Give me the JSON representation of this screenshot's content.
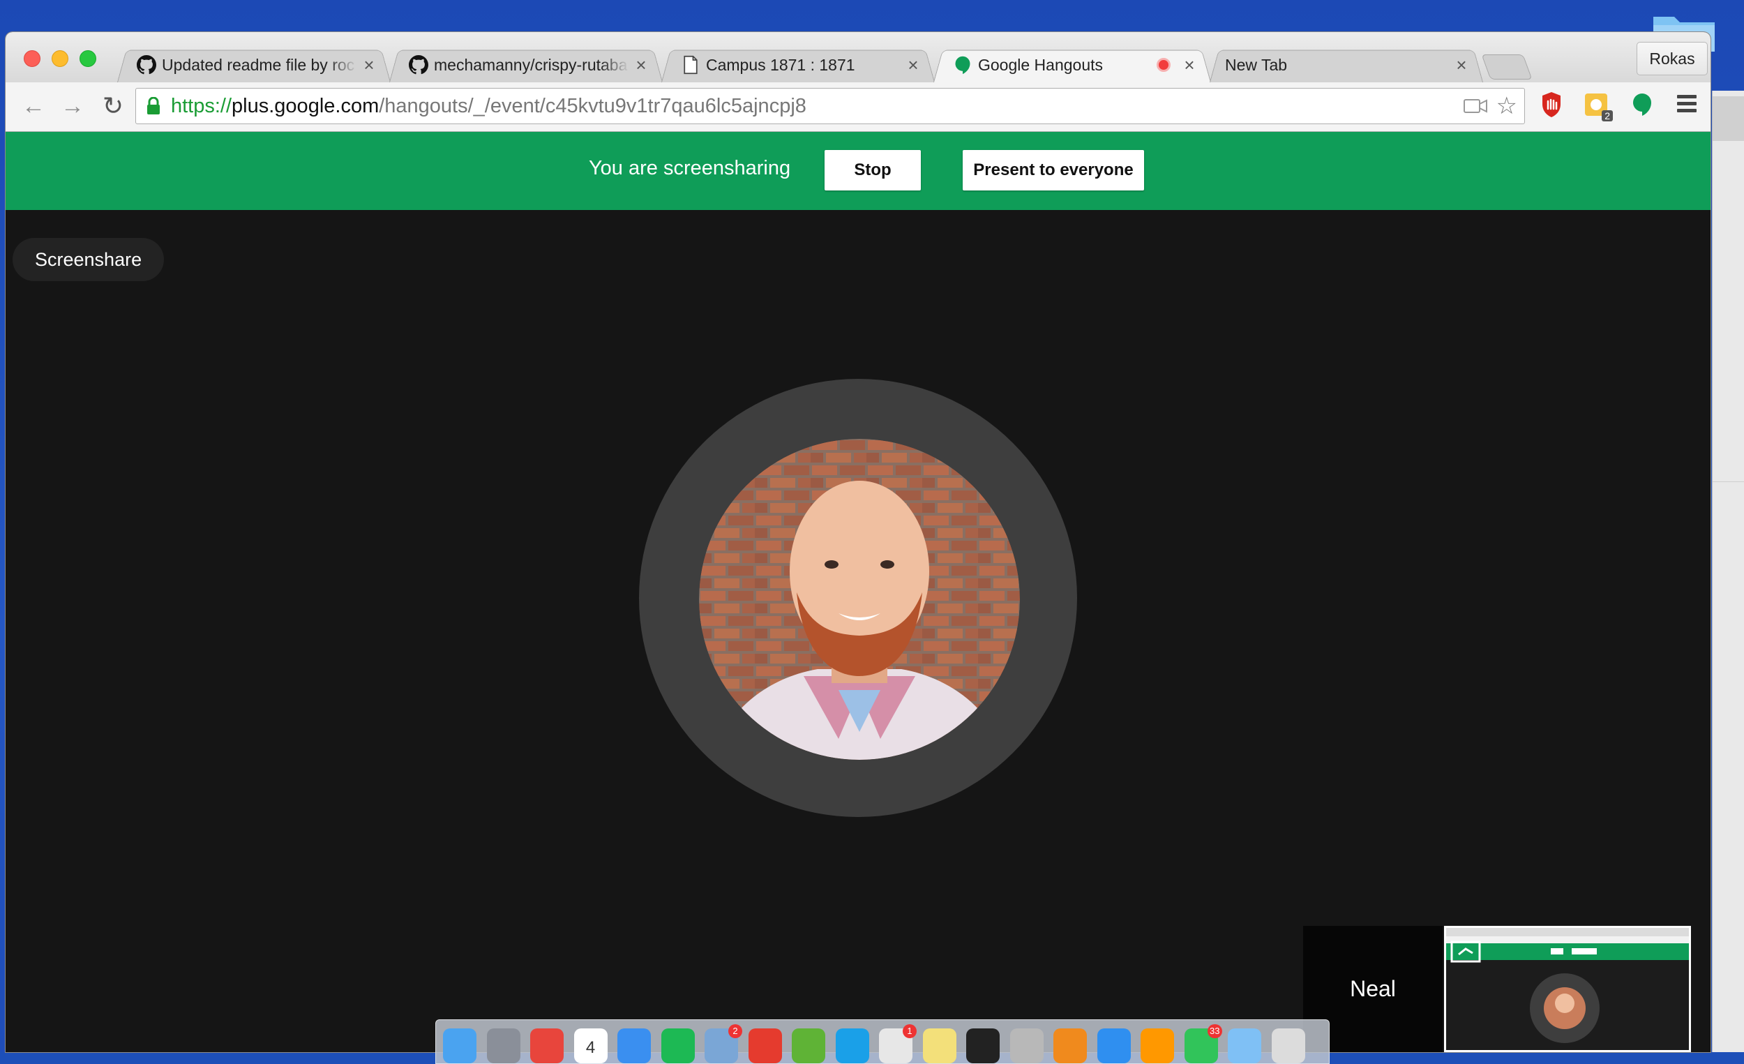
{
  "browser": {
    "tabs": [
      {
        "title": "Updated readme file by roc",
        "favicon": "github-icon",
        "active": false
      },
      {
        "title": "mechamanny/crispy-rutaba",
        "favicon": "github-icon",
        "active": false
      },
      {
        "title": "Campus 1871 : 1871",
        "favicon": "document-icon",
        "active": false
      },
      {
        "title": "Google Hangouts",
        "favicon": "hangouts-icon",
        "active": true,
        "recording": true
      },
      {
        "title": "New Tab",
        "favicon": null,
        "active": false
      }
    ],
    "close_glyph": "×",
    "profile_name": "Rokas",
    "url": {
      "scheme": "https://",
      "host": "plus.google.com",
      "path": "/hangouts/_/event/c45kvtu9v1tr7qau6lc5ajncpj8"
    },
    "extensions": [
      "stop-hand-icon",
      "gear-badge-icon",
      "hangouts-icon"
    ],
    "extension_badge": "2"
  },
  "hangout": {
    "banner_color": "#0f9d58",
    "banner_message": "You are screensharing",
    "stop_label": "Stop",
    "present_label": "Present to everyone",
    "chip_label": "Screenshare",
    "participant_name": "Neal"
  },
  "dock": {
    "items": [
      {
        "name": "finder",
        "color": "#4aa3f0"
      },
      {
        "name": "launchpad",
        "color": "#8a8f99"
      },
      {
        "name": "chrome",
        "color": "#e8453c"
      },
      {
        "name": "calendar",
        "color": "#ffffff",
        "label": "4"
      },
      {
        "name": "messages",
        "color": "#3a8ff0"
      },
      {
        "name": "spotify",
        "color": "#1db954"
      },
      {
        "name": "preview",
        "color": "#7aa6d6",
        "badge": "2"
      },
      {
        "name": "tomato",
        "color": "#e53b2e"
      },
      {
        "name": "evernote",
        "color": "#5fb336"
      },
      {
        "name": "skype",
        "color": "#1aa0e8"
      },
      {
        "name": "slack",
        "color": "#e7e7e7",
        "badge": "1"
      },
      {
        "name": "notes",
        "color": "#f3e07a"
      },
      {
        "name": "terminal",
        "color": "#222222"
      },
      {
        "name": "calculator",
        "color": "#b8b8b8"
      },
      {
        "name": "vlc",
        "color": "#f08a1d"
      },
      {
        "name": "safari",
        "color": "#2f8ff0"
      },
      {
        "name": "sublime",
        "color": "#ff9800"
      },
      {
        "name": "facetime",
        "color": "#31c45a",
        "badge": "33"
      },
      {
        "name": "folder",
        "color": "#7fc0f5"
      },
      {
        "name": "trash",
        "color": "#dcdcdc"
      }
    ]
  }
}
